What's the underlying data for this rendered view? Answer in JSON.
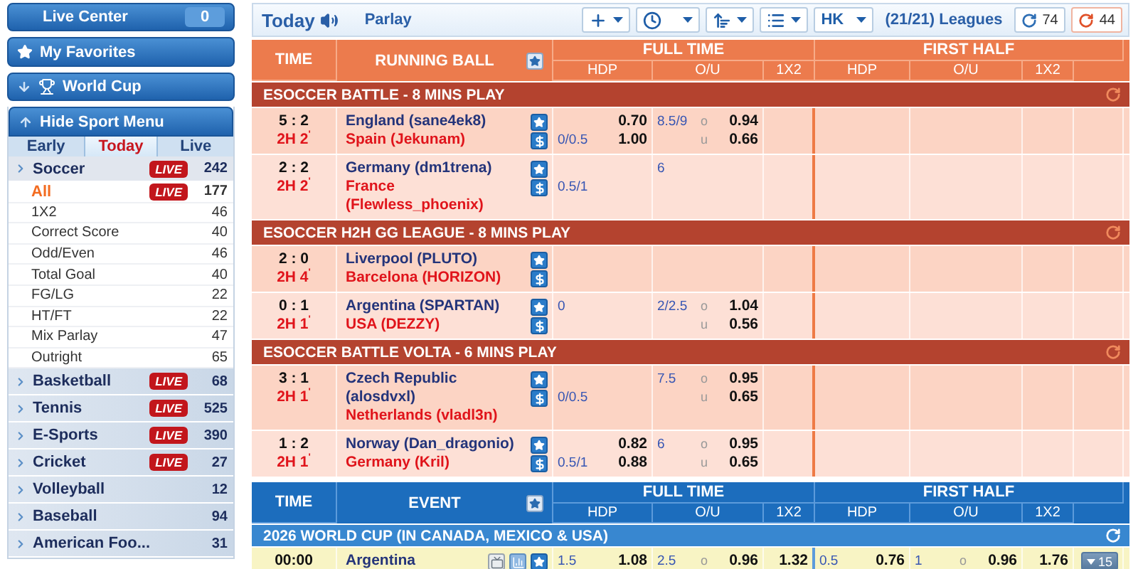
{
  "sidebar": {
    "live_center": {
      "label": "Live Center",
      "count": "0"
    },
    "favorites": {
      "label": "My Favorites"
    },
    "world_cup": {
      "label": "World Cup"
    },
    "sport_menu": {
      "label": "Hide Sport Menu"
    },
    "tabs": [
      {
        "label": "Early",
        "selected": false
      },
      {
        "label": "Today",
        "selected": true
      },
      {
        "label": "Live",
        "selected": false
      }
    ],
    "sports": [
      {
        "name": "Soccer",
        "badge": "LIVE",
        "count": "242",
        "expanded": true,
        "children": [
          {
            "name": "All",
            "badge": "LIVE",
            "count": "177",
            "selected": true
          },
          {
            "name": "1X2",
            "count": "46",
            "selected": false
          },
          {
            "name": "Correct Score",
            "count": "40",
            "selected": false
          },
          {
            "name": "Odd/Even",
            "count": "46",
            "selected": false
          },
          {
            "name": "Total Goal",
            "count": "40",
            "selected": false
          },
          {
            "name": "FG/LG",
            "count": "22",
            "selected": false
          },
          {
            "name": "HT/FT",
            "count": "22",
            "selected": false
          },
          {
            "name": "Mix Parlay",
            "count": "47",
            "selected": false
          },
          {
            "name": "Outright",
            "count": "65",
            "selected": false
          }
        ]
      },
      {
        "name": "Basketball",
        "badge": "LIVE",
        "count": "68",
        "expanded": false
      },
      {
        "name": "Tennis",
        "badge": "LIVE",
        "count": "525",
        "expanded": false
      },
      {
        "name": "E-Sports",
        "badge": "LIVE",
        "count": "390",
        "expanded": false
      },
      {
        "name": "Cricket",
        "badge": "LIVE",
        "count": "27",
        "expanded": false
      },
      {
        "name": "Volleyball",
        "count": "12",
        "expanded": false
      },
      {
        "name": "Baseball",
        "count": "94",
        "expanded": false
      },
      {
        "name": "American Foo...",
        "count": "31",
        "expanded": false
      }
    ]
  },
  "toolbar": {
    "title": "Today",
    "parlay": "Parlay",
    "menus": [
      {
        "kind": "plus"
      },
      {
        "kind": "clock"
      },
      {
        "kind": "sort"
      },
      {
        "kind": "list"
      }
    ],
    "odds_type": "HK",
    "leagues": "(21/21) Leagues",
    "refresh": [
      {
        "count": "74",
        "color": "#2f6fb5"
      },
      {
        "count": "44",
        "color": "#e0522a"
      }
    ]
  },
  "tables": [
    {
      "kind": "live",
      "headers": {
        "time": "TIME",
        "event": "RUNNING BALL",
        "full_time": "FULL TIME",
        "first_half": "FIRST HALF",
        "columns": [
          "HDP",
          "O/U",
          "1X2",
          "HDP",
          "O/U",
          "1X2"
        ]
      },
      "leagues": [
        {
          "name": "ESOCCER BATTLE - 8 MINS PLAY",
          "matches": [
            {
              "score": "5 : 2",
              "period": "2H 2$^{'}$",
              "home": "England (sane4ek8)",
              "away": "Spain (Jekunam)",
              "icons": [
                {
                  "kind": "star"
                },
                {
                  "kind": "dollar"
                }
              ],
              "ft": {
                "hdp": {
                  "line": "0/0.5",
                  "line_on_away": true,
                  "home_odds": "0.70",
                  "away_odds": "1.00"
                },
                "ou": {
                  "line": "8.5/9",
                  "over": {
                    "label": "o",
                    "odds": "0.94"
                  },
                  "under": {
                    "label": "u",
                    "odds": "0.66"
                  }
                }
              }
            },
            {
              "score": "2 : 2",
              "period": "2H 2$^{'}$",
              "home": "Germany (dm1trena)",
              "away": "France (Flewless_phoenix)",
              "icons": [
                {
                  "kind": "star"
                },
                {
                  "kind": "dollar"
                }
              ],
              "ft": {
                "hdp": {
                  "line": "0.5/1",
                  "line_on_away": true
                },
                "ou": {
                  "line": "6"
                }
              }
            }
          ]
        },
        {
          "name": "ESOCCER H2H GG LEAGUE - 8 MINS PLAY",
          "matches": [
            {
              "score": "2 : 0",
              "period": "2H 4$^{'}$",
              "home": "Liverpool (PLUTO)",
              "away": "Barcelona (HORIZON)",
              "icons": [
                {
                  "kind": "star"
                },
                {
                  "kind": "dollar"
                }
              ]
            },
            {
              "score": "0 : 1",
              "period": "2H 1$^{'}$",
              "home": "Argentina (SPARTAN)",
              "away": "USA (DEZZY)",
              "icons": [
                {
                  "kind": "star"
                },
                {
                  "kind": "dollar"
                }
              ],
              "ft": {
                "hdp": {
                  "line": "0",
                  "line_on_away": false
                },
                "ou": {
                  "line": "2/2.5",
                  "over": {
                    "label": "o",
                    "odds": "1.04"
                  },
                  "under": {
                    "label": "u",
                    "odds": "0.56"
                  }
                }
              }
            }
          ]
        },
        {
          "name": "ESOCCER BATTLE VOLTA - 6 MINS PLAY",
          "matches": [
            {
              "score": "3 : 1",
              "period": "2H 1$^{'}$",
              "home": "Czech Republic (alosdvxl)",
              "away": "Netherlands (vladl3n)",
              "icons": [
                {
                  "kind": "star"
                },
                {
                  "kind": "dollar"
                }
              ],
              "ft": {
                "hdp": {
                  "line": "0/0.5",
                  "line_on_away": true
                },
                "ou": {
                  "line": "7.5",
                  "over": {
                    "label": "o",
                    "odds": "0.95"
                  },
                  "under": {
                    "label": "u",
                    "odds": "0.65"
                  }
                }
              }
            },
            {
              "score": "1 : 2",
              "period": "2H 1$^{'}$",
              "home": "Norway (Dan_dragonio)",
              "away": "Germany (Kril)",
              "icons": [
                {
                  "kind": "star"
                },
                {
                  "kind": "dollar"
                }
              ],
              "ft": {
                "hdp": {
                  "line": "0.5/1",
                  "line_on_away": true,
                  "home_odds": "0.82",
                  "away_odds": "0.88"
                },
                "ou": {
                  "line": "6",
                  "over": {
                    "label": "o",
                    "odds": "0.95"
                  },
                  "under": {
                    "label": "u",
                    "odds": "0.65"
                  }
                }
              }
            }
          ]
        }
      ]
    },
    {
      "kind": "prematch",
      "headers": {
        "time": "TIME",
        "event": "EVENT",
        "full_time": "FULL TIME",
        "first_half": "FIRST HALF",
        "columns": [
          "HDP",
          "O/U",
          "1X2",
          "HDP",
          "O/U",
          "1X2"
        ]
      },
      "leagues": [
        {
          "name": "2026 WORLD CUP (IN CANADA, MEXICO & USA)",
          "matches": [
            {
              "time": "00:00",
              "home": "Argentina",
              "icons": [
                {
                  "kind": "tv"
                },
                {
                  "kind": "chart"
                },
                {
                  "kind": "star"
                }
              ],
              "more": "15",
              "ft": {
                "hdp": {
                  "line": "1.5",
                  "line_on_away": false,
                  "home_odds": "1.08"
                },
                "ou": {
                  "line": "2.5",
                  "over": {
                    "label": "o",
                    "odds": "0.96"
                  }
                },
                "x12": [
                  "1.32"
                ]
              },
              "fh": {
                "hdp": {
                  "line": "0.5",
                  "line_on_away": false,
                  "home_odds": "0.76"
                },
                "ou": {
                  "line": "1",
                  "over": {
                    "label": "o",
                    "odds": "0.96"
                  }
                },
                "x12": [
                  "1.76"
                ]
              }
            }
          ]
        }
      ]
    }
  ]
}
